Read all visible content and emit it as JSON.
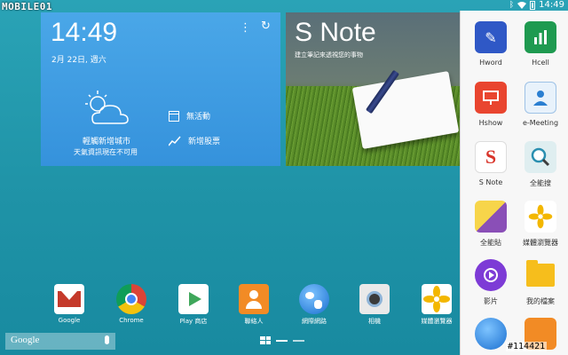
{
  "watermarks": {
    "top_left": "MOBILE01",
    "bottom_right": "#114421"
  },
  "status": {
    "time": "14:49"
  },
  "clock_widget": {
    "time": "14:49",
    "date": "2月 22日, 週六",
    "city": "輕觸新增城市",
    "weather_message": "天氣資訊現在不可用",
    "events_label": "無活動",
    "stocks_label": "新增股票"
  },
  "snote_widget": {
    "title": "S Note",
    "subtitle": "建立筆記來透視您的事物"
  },
  "dock": [
    {
      "label": "Google",
      "icon": "gmail-icon"
    },
    {
      "label": "Chrome",
      "icon": "chrome-icon"
    },
    {
      "label": "Play 商店",
      "icon": "play-store-icon"
    },
    {
      "label": "聯絡人",
      "icon": "contacts-icon"
    },
    {
      "label": "網際網路",
      "icon": "internet-icon"
    },
    {
      "label": "相機",
      "icon": "camera-icon"
    },
    {
      "label": "媒體瀏覽器",
      "icon": "media-browser-icon"
    }
  ],
  "search": {
    "label": "Google"
  },
  "drawer": [
    {
      "label": "Hword",
      "icon": "hword-icon"
    },
    {
      "label": "Hcell",
      "icon": "hcell-icon"
    },
    {
      "label": "Hshow",
      "icon": "hshow-icon"
    },
    {
      "label": "e-Meeting",
      "icon": "emeeting-icon"
    },
    {
      "label": "S Note",
      "icon": "snote-icon"
    },
    {
      "label": "全能搜",
      "icon": "search-app-icon"
    },
    {
      "label": "全能貼",
      "icon": "scrapbook-icon"
    },
    {
      "label": "媒體瀏覽器",
      "icon": "media-browser-icon"
    },
    {
      "label": "影片",
      "icon": "video-icon"
    },
    {
      "label": "我的檔案",
      "icon": "my-files-icon"
    }
  ]
}
